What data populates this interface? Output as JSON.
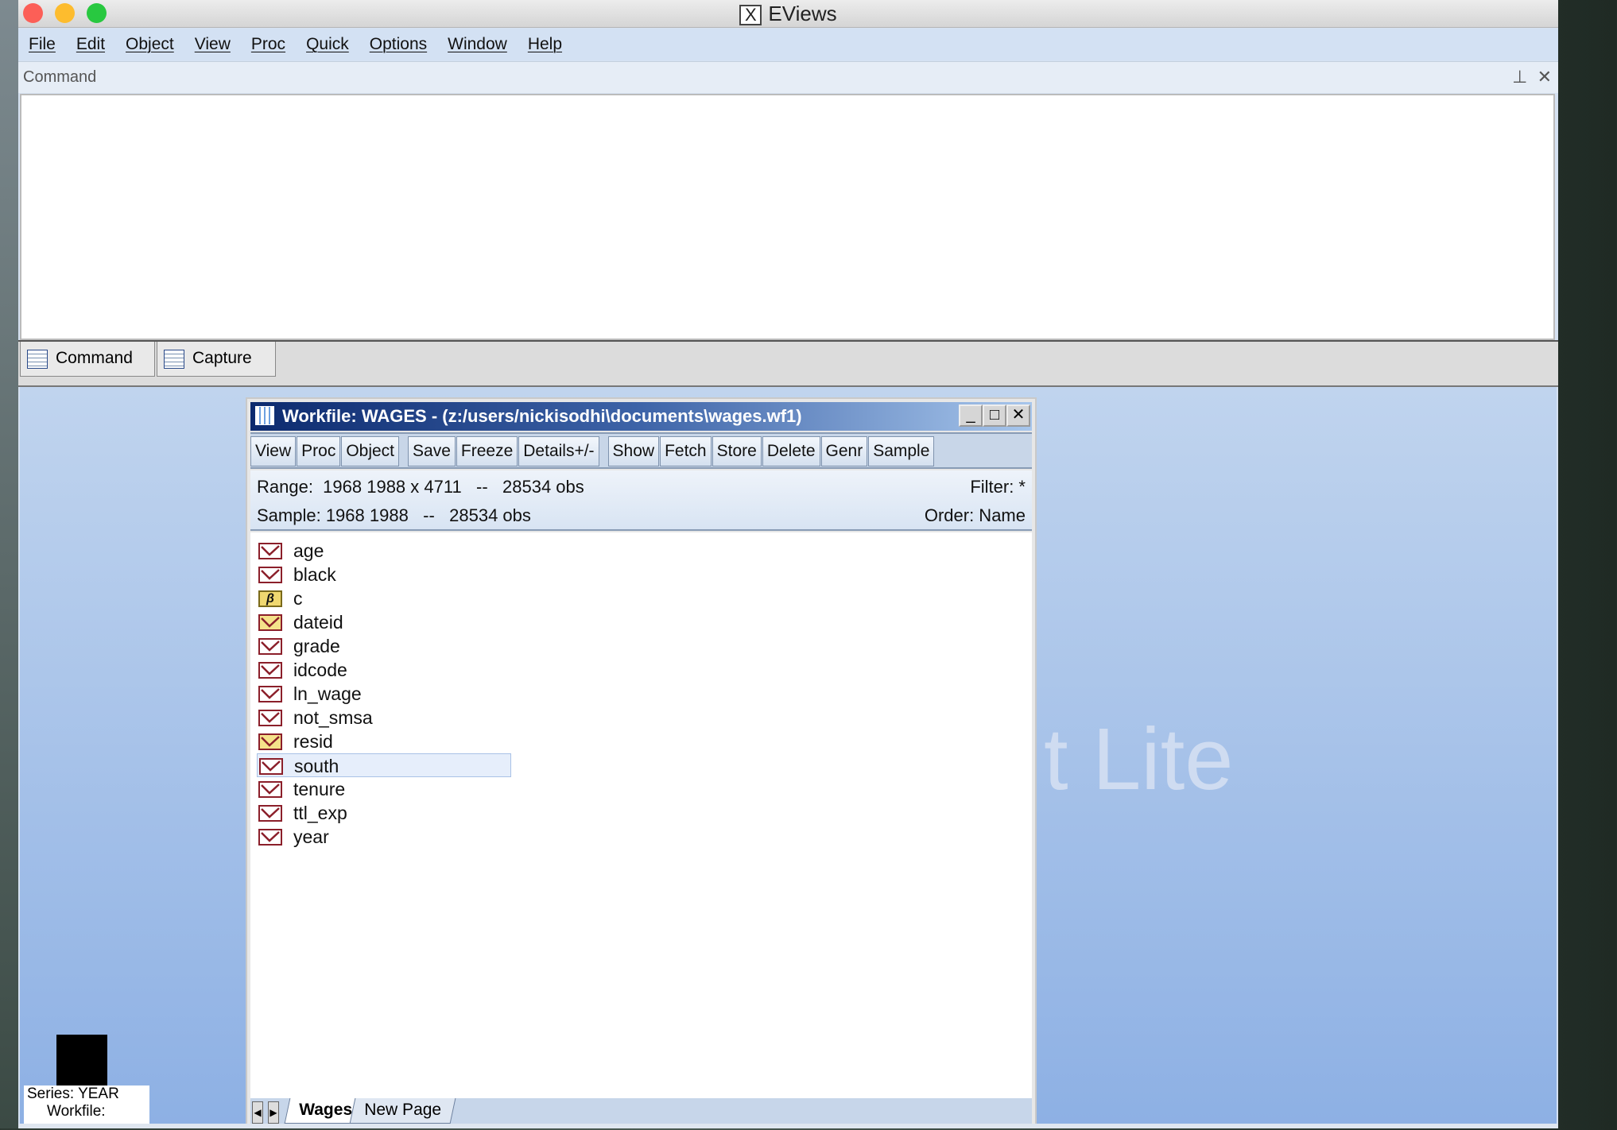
{
  "app": {
    "title": "EViews"
  },
  "menu": [
    "File",
    "Edit",
    "Object",
    "View",
    "Proc",
    "Quick",
    "Options",
    "Window",
    "Help"
  ],
  "command_pane": {
    "label": "Command",
    "pin": "pin-icon",
    "close": "✕"
  },
  "bottom_tabs": [
    "Command",
    "Capture"
  ],
  "watermark": "t Lite",
  "workfile": {
    "title": "Workfile: WAGES - (z:/users/nickisodhi\\documents\\wages.wf1)",
    "toolbar": [
      "View",
      "Proc",
      "Object",
      "Save",
      "Freeze",
      "Details+/-",
      "Show",
      "Fetch",
      "Store",
      "Delete",
      "Genr",
      "Sample"
    ],
    "range": "Range:  1968 1988 x 4711   --   28534 obs",
    "sample": "Sample: 1968 1988   --   28534 obs",
    "filter": "Filter: *",
    "order": "Order: Name",
    "objects": [
      {
        "name": "age",
        "icon": "series-icon"
      },
      {
        "name": "black",
        "icon": "series-icon"
      },
      {
        "name": "c",
        "icon": "coefficient-icon"
      },
      {
        "name": "dateid",
        "icon": "series-icon-yellow"
      },
      {
        "name": "grade",
        "icon": "series-icon"
      },
      {
        "name": "idcode",
        "icon": "series-icon"
      },
      {
        "name": "ln_wage",
        "icon": "series-icon"
      },
      {
        "name": "not_smsa",
        "icon": "series-icon"
      },
      {
        "name": "resid",
        "icon": "series-icon-yellow"
      },
      {
        "name": "south",
        "icon": "series-icon",
        "selected": true
      },
      {
        "name": "tenure",
        "icon": "series-icon"
      },
      {
        "name": "ttl_exp",
        "icon": "series-icon"
      },
      {
        "name": "year",
        "icon": "series-icon"
      }
    ],
    "page_tabs": [
      "Wages",
      "New Page"
    ],
    "active_page": "Wages"
  },
  "minimized": {
    "line1": "Series: YEAR",
    "line2": "Workfile:"
  }
}
